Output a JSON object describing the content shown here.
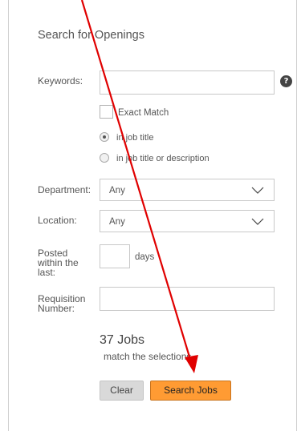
{
  "panel": {
    "title": "Search for Openings"
  },
  "keywords": {
    "label": "Keywords:",
    "value": "",
    "help_icon": "question-circle-icon",
    "help_glyph": "?"
  },
  "exact_match": {
    "label": "Exact Match",
    "checked": false
  },
  "search_scope": {
    "options": [
      {
        "label": "in job title",
        "selected": true
      },
      {
        "label": "in job title or description",
        "selected": false
      }
    ]
  },
  "department": {
    "label": "Department:",
    "selected": "Any"
  },
  "location": {
    "label": "Location:",
    "selected": "Any"
  },
  "posted": {
    "label_lines": [
      "Posted",
      "within the",
      "last:"
    ],
    "value": "",
    "unit": "days"
  },
  "requisition": {
    "label_lines": [
      "Requisition",
      "Number:"
    ],
    "value": ""
  },
  "results": {
    "count": "37 Jobs",
    "subtitle": "match the selections"
  },
  "buttons": {
    "clear": "Clear",
    "search": "Search Jobs"
  },
  "colors": {
    "accent_button": "#ff9b33",
    "annotation_arrow": "#e00000"
  }
}
